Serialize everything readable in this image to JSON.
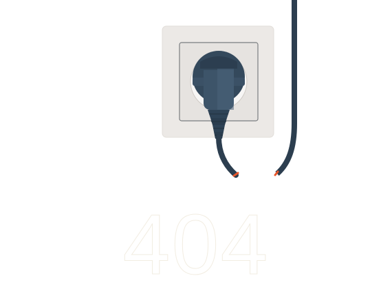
{
  "error": {
    "code": "404"
  },
  "colors": {
    "background": "#ffffff",
    "socket_plate": "#ece9e6",
    "socket_inner": "#e4e1de",
    "cable": "#2c3e4f",
    "plug_body": "#34495c",
    "plug_highlight": "#4b627a",
    "wire_tip": "#e8562a",
    "code_outline": "#f2ede2"
  },
  "icons": {
    "socket": "wall-socket-icon",
    "plug": "plug-icon",
    "unplugged_cable": "cable-icon"
  }
}
